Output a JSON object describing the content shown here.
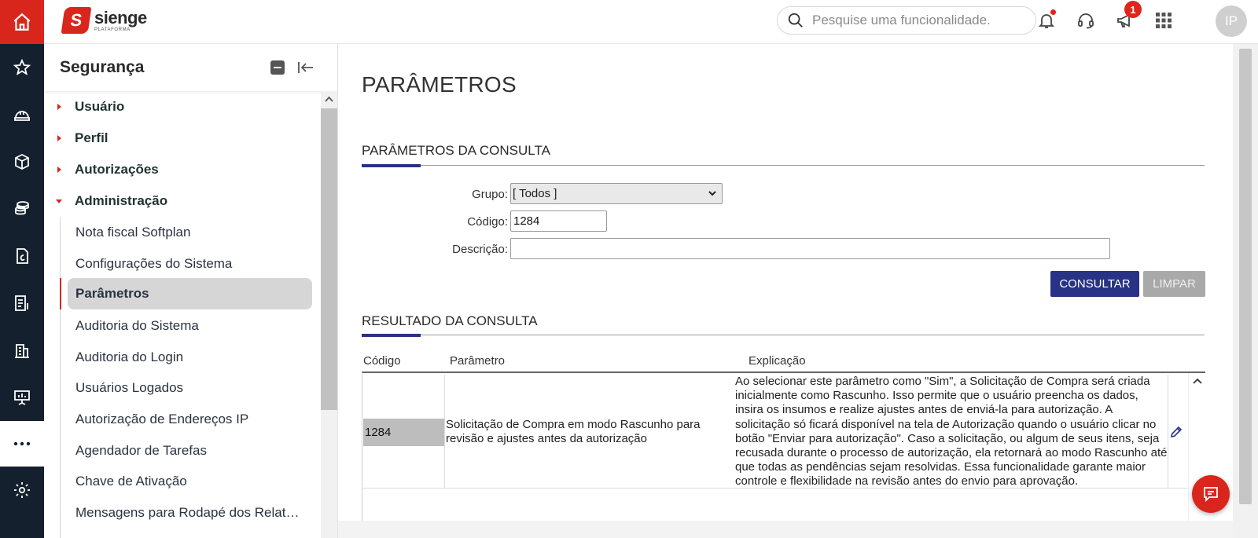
{
  "brand": {
    "name": "sienge",
    "subtitle": "PLATAFORMA",
    "logo_letter": "S",
    "accent_color": "#d9261c",
    "primary_color": "#283286"
  },
  "topbar": {
    "search_placeholder": "Pesquise uma funcionalidade.",
    "announcement_badge": "1",
    "user_initials": "IP",
    "icons": [
      "search-icon",
      "bell-icon",
      "headset-icon",
      "megaphone-icon",
      "apps-grid-icon"
    ]
  },
  "rail": {
    "items": [
      "home-icon",
      "star-icon",
      "helmet-icon",
      "box-icon",
      "coins-icon",
      "document-icon",
      "invoice-icon",
      "building-icon",
      "presentation-icon",
      "more-icon",
      "settings-icon"
    ]
  },
  "menu": {
    "title": "Segurança",
    "groups": [
      {
        "label": "Usuário",
        "expanded": false
      },
      {
        "label": "Perfil",
        "expanded": false
      },
      {
        "label": "Autorizações",
        "expanded": false
      },
      {
        "label": "Administração",
        "expanded": true
      }
    ],
    "items": [
      "Nota fiscal Softplan",
      "Configurações do Sistema",
      "Parâmetros",
      "Auditoria do Sistema",
      "Auditoria do Login",
      "Usuários Logados",
      "Autorização de Endereços IP",
      "Agendador de Tarefas",
      "Chave de Ativação",
      "Mensagens para Rodapé dos Relat…"
    ],
    "active_item": "Parâmetros"
  },
  "page": {
    "title": "PARÂMETROS",
    "query_section": "PARÂMETROS DA CONSULTA",
    "result_section": "RESULTADO DA CONSULTA",
    "form": {
      "group_label": "Grupo:",
      "group_value": "[ Todos ]",
      "code_label": "Código:",
      "code_value": "1284",
      "description_label": "Descrição:",
      "description_value": ""
    },
    "buttons": {
      "query": "CONSULTAR",
      "clear": "LIMPAR"
    },
    "table": {
      "columns": [
        "Código",
        "Parâmetro",
        "Explicação"
      ],
      "rows": [
        {
          "code": "1284",
          "parameter": "Solicitação de Compra em modo Rascunho para revisão e ajustes antes da autorização",
          "explanation": "Ao selecionar este parâmetro como \"Sim\", a Solicitação de Compra será criada inicialmente como Rascunho. Isso permite que o usuário preencha os dados, insira os insumos e realize ajustes antes de enviá-la para autorização. A solicitação só ficará disponível na tela de Autorização quando o usuário clicar no botão \"Enviar para autorização\". Caso a solicitação, ou algum de seus itens, seja recusada durante o processo de autorização, ela retornará ao modo Rascunho até que todas as pendências sejam resolvidas. Essa funcionalidade garante maior controle e flexibilidade na revisão antes do envio para aprovação."
        }
      ]
    }
  }
}
